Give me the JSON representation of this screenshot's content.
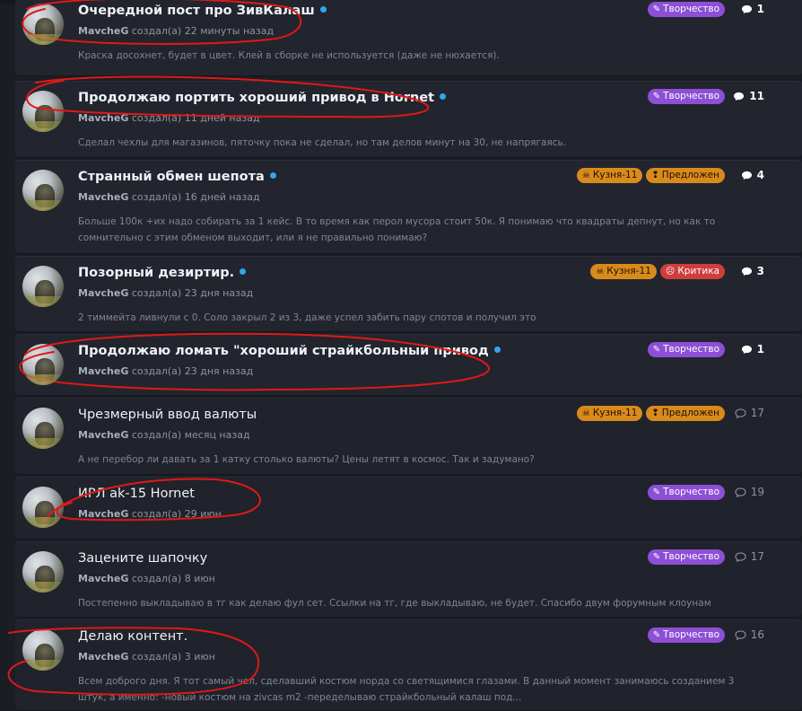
{
  "threads": [
    {
      "title": "Очередной пост про ЗивКалаш",
      "unread": true,
      "author": "MavcheG",
      "created_phrase": "создал(а)",
      "time": "22 минуты назад",
      "snippet": "Краска досохнет, будет в цвет. Клей в сборке не используется (даже не нюхается).",
      "tags": [
        {
          "label": "Творчество",
          "color": "purple",
          "icon": "brush-icon"
        }
      ],
      "replies": "1"
    },
    {
      "title": "Продолжаю портить хороший привод в Hornet",
      "unread": true,
      "author": "MavcheG",
      "created_phrase": "создал(а)",
      "time": "11 дней назад",
      "snippet": "Сделал чехлы для магазинов, пяточку пока не сделал, но там делов минут на 30, не напрягаясь.",
      "tags": [
        {
          "label": "Творчество",
          "color": "purple",
          "icon": "brush-icon"
        }
      ],
      "replies": "11"
    },
    {
      "title": "Странный обмен шепота",
      "unread": true,
      "author": "MavcheG",
      "created_phrase": "создал(а)",
      "time": "16 дней назад",
      "snippet": "Больше 100к +их надо собирать за 1 кейс. В то время как перол мусора стоит 50к. Я понимаю что квадраты депнут, но как то сомнительно с этим обменом выходит, или я не правильно понимаю?",
      "tags": [
        {
          "label": "Кузня-11",
          "color": "orange",
          "icon": "skull-icon"
        },
        {
          "label": "Предложен",
          "color": "orange",
          "icon": "bulb-icon"
        }
      ],
      "replies": "4"
    },
    {
      "title": "Позорный дезиртир.",
      "unread": true,
      "author": "MavcheG",
      "created_phrase": "создал(а)",
      "time": "23 дня назад",
      "snippet": "2 тиммейта ливнули с 0. Соло закрыл 2 из 3, даже успел забить пару спотов и получил это",
      "tags": [
        {
          "label": "Кузня-11",
          "color": "orange",
          "icon": "skull-icon"
        },
        {
          "label": "Критика",
          "color": "red",
          "icon": "frown-icon"
        }
      ],
      "replies": "3"
    },
    {
      "title": "Продолжаю ломать \"хороший страйкбольный привод",
      "unread": true,
      "author": "MavcheG",
      "created_phrase": "создал(а)",
      "time": "23 дня назад",
      "snippet": "",
      "tags": [
        {
          "label": "Творчество",
          "color": "purple",
          "icon": "brush-icon"
        }
      ],
      "replies": "1"
    },
    {
      "title": "Чрезмерный ввод валюты",
      "unread": false,
      "author": "MavcheG",
      "created_phrase": "создал(а)",
      "time": "месяц назад",
      "snippet": "А не перебор ли давать за 1 катку столько валюты? Цены летят в космос. Так и задумано?",
      "tags": [
        {
          "label": "Кузня-11",
          "color": "orange",
          "icon": "skull-icon"
        },
        {
          "label": "Предложен",
          "color": "orange",
          "icon": "bulb-icon"
        }
      ],
      "replies": "17"
    },
    {
      "title": "ИРЛ ak-15 Hornet",
      "unread": false,
      "author": "MavcheG",
      "created_phrase": "создал(а)",
      "time": "29 июн",
      "snippet": "",
      "tags": [
        {
          "label": "Творчество",
          "color": "purple",
          "icon": "brush-icon"
        }
      ],
      "replies": "19"
    },
    {
      "title": "Зацените шапочку",
      "unread": false,
      "author": "MavcheG",
      "created_phrase": "создал(а)",
      "time": "8 июн",
      "snippet": "Постепенно выкладываю в тг как делаю фул сет. Ссылки на тг, где выкладываю, не будет. Спасибо двум форумным клоунам",
      "tags": [
        {
          "label": "Творчество",
          "color": "purple",
          "icon": "brush-icon"
        }
      ],
      "replies": "17"
    },
    {
      "title": "Делаю контент.",
      "unread": false,
      "author": "MavcheG",
      "created_phrase": "создал(а)",
      "time": "3 июн",
      "snippet": "Всем доброго дня. Я тот самый чел, сделавший костюм норда со светящимися глазами. В данный момент занимаюсь созданием 3 штук, а именно: -новый костюм на zivcas m2 -переделываю страйкбольный калаш под...",
      "tags": [
        {
          "label": "Творчество",
          "color": "purple",
          "icon": "brush-icon"
        }
      ],
      "replies": "16"
    }
  ],
  "colors": {
    "purple": "#8d4fd6",
    "orange": "#d98a1d",
    "red": "#cf3d3d",
    "unread_dot": "#2ea7ef",
    "scribble": "#e01818"
  }
}
